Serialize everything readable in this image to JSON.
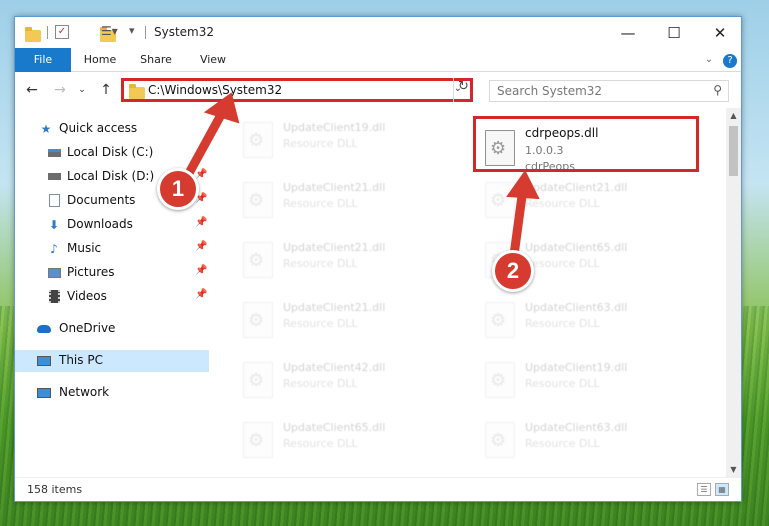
{
  "window": {
    "title": "System32",
    "controls": {
      "minimize": "—",
      "maximize": "☐",
      "close": "✕"
    }
  },
  "ribbon": {
    "tabs": [
      "File",
      "Home",
      "Share",
      "View"
    ],
    "expand_icon": "chevron-down-icon",
    "help_icon": "help-icon"
  },
  "address": {
    "path": "C:\\Windows\\System32",
    "search_placeholder": "Search System32"
  },
  "nav": {
    "items": [
      {
        "label": "Quick access",
        "icon": "star-icon"
      },
      {
        "label": "Local Disk (C:)",
        "icon": "drive-icon"
      },
      {
        "label": "Local Disk (D:)",
        "icon": "drive-icon"
      },
      {
        "label": "Documents",
        "icon": "documents-icon"
      },
      {
        "label": "Downloads",
        "icon": "download-icon"
      },
      {
        "label": "Music",
        "icon": "music-icon"
      },
      {
        "label": "Pictures",
        "icon": "pictures-icon"
      },
      {
        "label": "Videos",
        "icon": "videos-icon"
      },
      {
        "label": "OneDrive",
        "icon": "cloud-icon"
      },
      {
        "label": "This PC",
        "icon": "computer-icon"
      },
      {
        "label": "Network",
        "icon": "network-icon"
      }
    ]
  },
  "files": {
    "highlighted": {
      "name": "cdrpeops.dll",
      "version": "1.0.0.3",
      "company": "cdrPeops"
    },
    "left_column": [
      {
        "name": "UpdateClient19.dll",
        "type": "Resource DLL"
      },
      {
        "name": "UpdateClient21.dll",
        "type": "Resource DLL"
      },
      {
        "name": "UpdateClient21.dll",
        "type": "Resource DLL"
      },
      {
        "name": "UpdateClient21.dll",
        "type": "Resource DLL"
      },
      {
        "name": "UpdateClient42.dll",
        "type": "Resource DLL"
      },
      {
        "name": "UpdateClient65.dll",
        "type": "Resource DLL"
      }
    ],
    "right_column": [
      {
        "name": "UpdateClient21.dll",
        "type": "Resource DLL"
      },
      {
        "name": "UpdateClient65.dll",
        "type": "Resource DLL"
      },
      {
        "name": "UpdateClient63.dll",
        "type": "Resource DLL"
      },
      {
        "name": "UpdateClient19.dll",
        "type": "Resource DLL"
      },
      {
        "name": "UpdateClient63.dll",
        "type": "Resource DLL"
      }
    ]
  },
  "status": {
    "item_count": "158 items"
  },
  "annotations": [
    {
      "number": "1"
    },
    {
      "number": "2"
    }
  ],
  "colors": {
    "accent": "#1979ca",
    "highlight": "#d42828",
    "selection": "#cce8ff"
  }
}
